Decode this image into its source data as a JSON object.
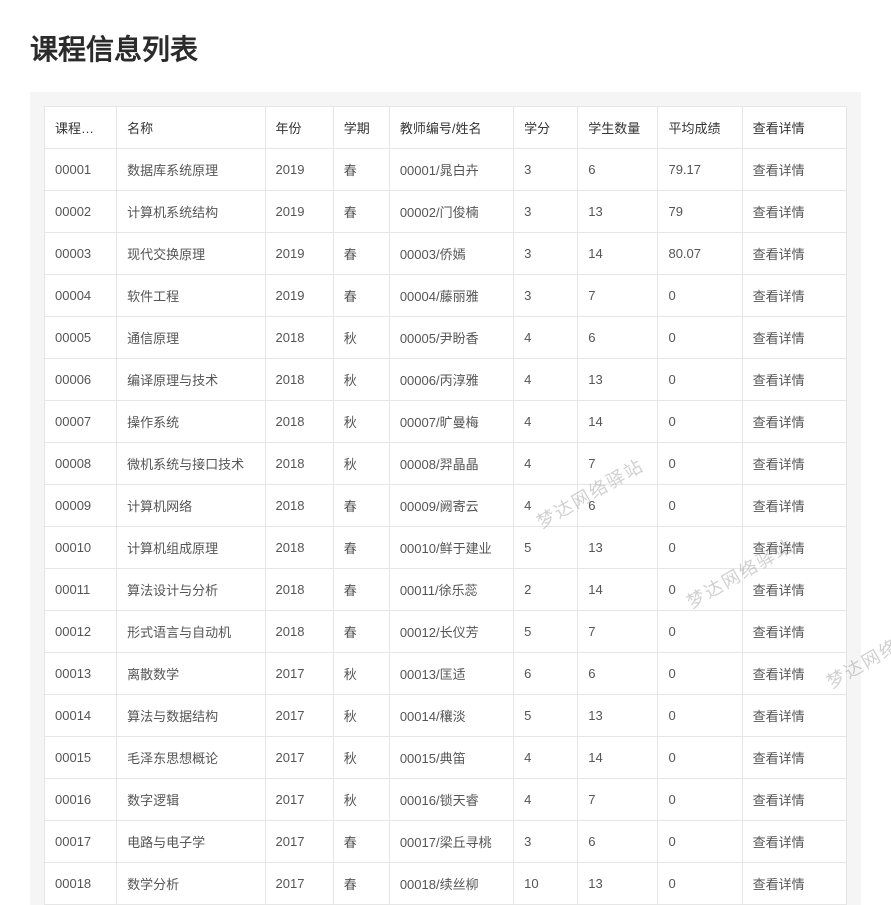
{
  "page": {
    "title": "课程信息列表"
  },
  "watermark": "梦达网络驿站",
  "table": {
    "headers": {
      "course_id": "课程编号",
      "name": "名称",
      "year": "年份",
      "semester": "学期",
      "teacher": "教师编号/姓名",
      "credit": "学分",
      "student_count": "学生数量",
      "avg_score": "平均成绩",
      "detail": "查看详情"
    },
    "detail_link_label": "查看详情",
    "rows": [
      {
        "course_id": "00001",
        "name": "数据库系统原理",
        "year": "2019",
        "semester": "春",
        "teacher": "00001/晁白卉",
        "credit": "3",
        "student_count": "6",
        "avg_score": "79.17"
      },
      {
        "course_id": "00002",
        "name": "计算机系统结构",
        "year": "2019",
        "semester": "春",
        "teacher": "00002/门俊楠",
        "credit": "3",
        "student_count": "13",
        "avg_score": "79"
      },
      {
        "course_id": "00003",
        "name": "现代交换原理",
        "year": "2019",
        "semester": "春",
        "teacher": "00003/侨嫣",
        "credit": "3",
        "student_count": "14",
        "avg_score": "80.07"
      },
      {
        "course_id": "00004",
        "name": "软件工程",
        "year": "2019",
        "semester": "春",
        "teacher": "00004/藤丽雅",
        "credit": "3",
        "student_count": "7",
        "avg_score": "0"
      },
      {
        "course_id": "00005",
        "name": "通信原理",
        "year": "2018",
        "semester": "秋",
        "teacher": "00005/尹盼香",
        "credit": "4",
        "student_count": "6",
        "avg_score": "0"
      },
      {
        "course_id": "00006",
        "name": "编译原理与技术",
        "year": "2018",
        "semester": "秋",
        "teacher": "00006/丙淳雅",
        "credit": "4",
        "student_count": "13",
        "avg_score": "0"
      },
      {
        "course_id": "00007",
        "name": "操作系统",
        "year": "2018",
        "semester": "秋",
        "teacher": "00007/旷曼梅",
        "credit": "4",
        "student_count": "14",
        "avg_score": "0"
      },
      {
        "course_id": "00008",
        "name": "微机系统与接口技术",
        "year": "2018",
        "semester": "秋",
        "teacher": "00008/羿晶晶",
        "credit": "4",
        "student_count": "7",
        "avg_score": "0"
      },
      {
        "course_id": "00009",
        "name": "计算机网络",
        "year": "2018",
        "semester": "春",
        "teacher": "00009/阙寄云",
        "credit": "4",
        "student_count": "6",
        "avg_score": "0"
      },
      {
        "course_id": "00010",
        "name": "计算机组成原理",
        "year": "2018",
        "semester": "春",
        "teacher": "00010/鲜于建业",
        "credit": "5",
        "student_count": "13",
        "avg_score": "0"
      },
      {
        "course_id": "00011",
        "name": "算法设计与分析",
        "year": "2018",
        "semester": "春",
        "teacher": "00011/徐乐蕊",
        "credit": "2",
        "student_count": "14",
        "avg_score": "0"
      },
      {
        "course_id": "00012",
        "name": "形式语言与自动机",
        "year": "2018",
        "semester": "春",
        "teacher": "00012/长仪芳",
        "credit": "5",
        "student_count": "7",
        "avg_score": "0"
      },
      {
        "course_id": "00013",
        "name": "离散数学",
        "year": "2017",
        "semester": "秋",
        "teacher": "00013/匡适",
        "credit": "6",
        "student_count": "6",
        "avg_score": "0"
      },
      {
        "course_id": "00014",
        "name": "算法与数据结构",
        "year": "2017",
        "semester": "秋",
        "teacher": "00014/穰淡",
        "credit": "5",
        "student_count": "13",
        "avg_score": "0"
      },
      {
        "course_id": "00015",
        "name": "毛泽东思想概论",
        "year": "2017",
        "semester": "秋",
        "teacher": "00015/典笛",
        "credit": "4",
        "student_count": "14",
        "avg_score": "0"
      },
      {
        "course_id": "00016",
        "name": "数字逻辑",
        "year": "2017",
        "semester": "秋",
        "teacher": "00016/锁天睿",
        "credit": "4",
        "student_count": "7",
        "avg_score": "0"
      },
      {
        "course_id": "00017",
        "name": "电路与电子学",
        "year": "2017",
        "semester": "春",
        "teacher": "00017/梁丘寻桃",
        "credit": "3",
        "student_count": "6",
        "avg_score": "0"
      },
      {
        "course_id": "00018",
        "name": "数学分析",
        "year": "2017",
        "semester": "春",
        "teacher": "00018/续丝柳",
        "credit": "10",
        "student_count": "13",
        "avg_score": "0"
      }
    ]
  }
}
